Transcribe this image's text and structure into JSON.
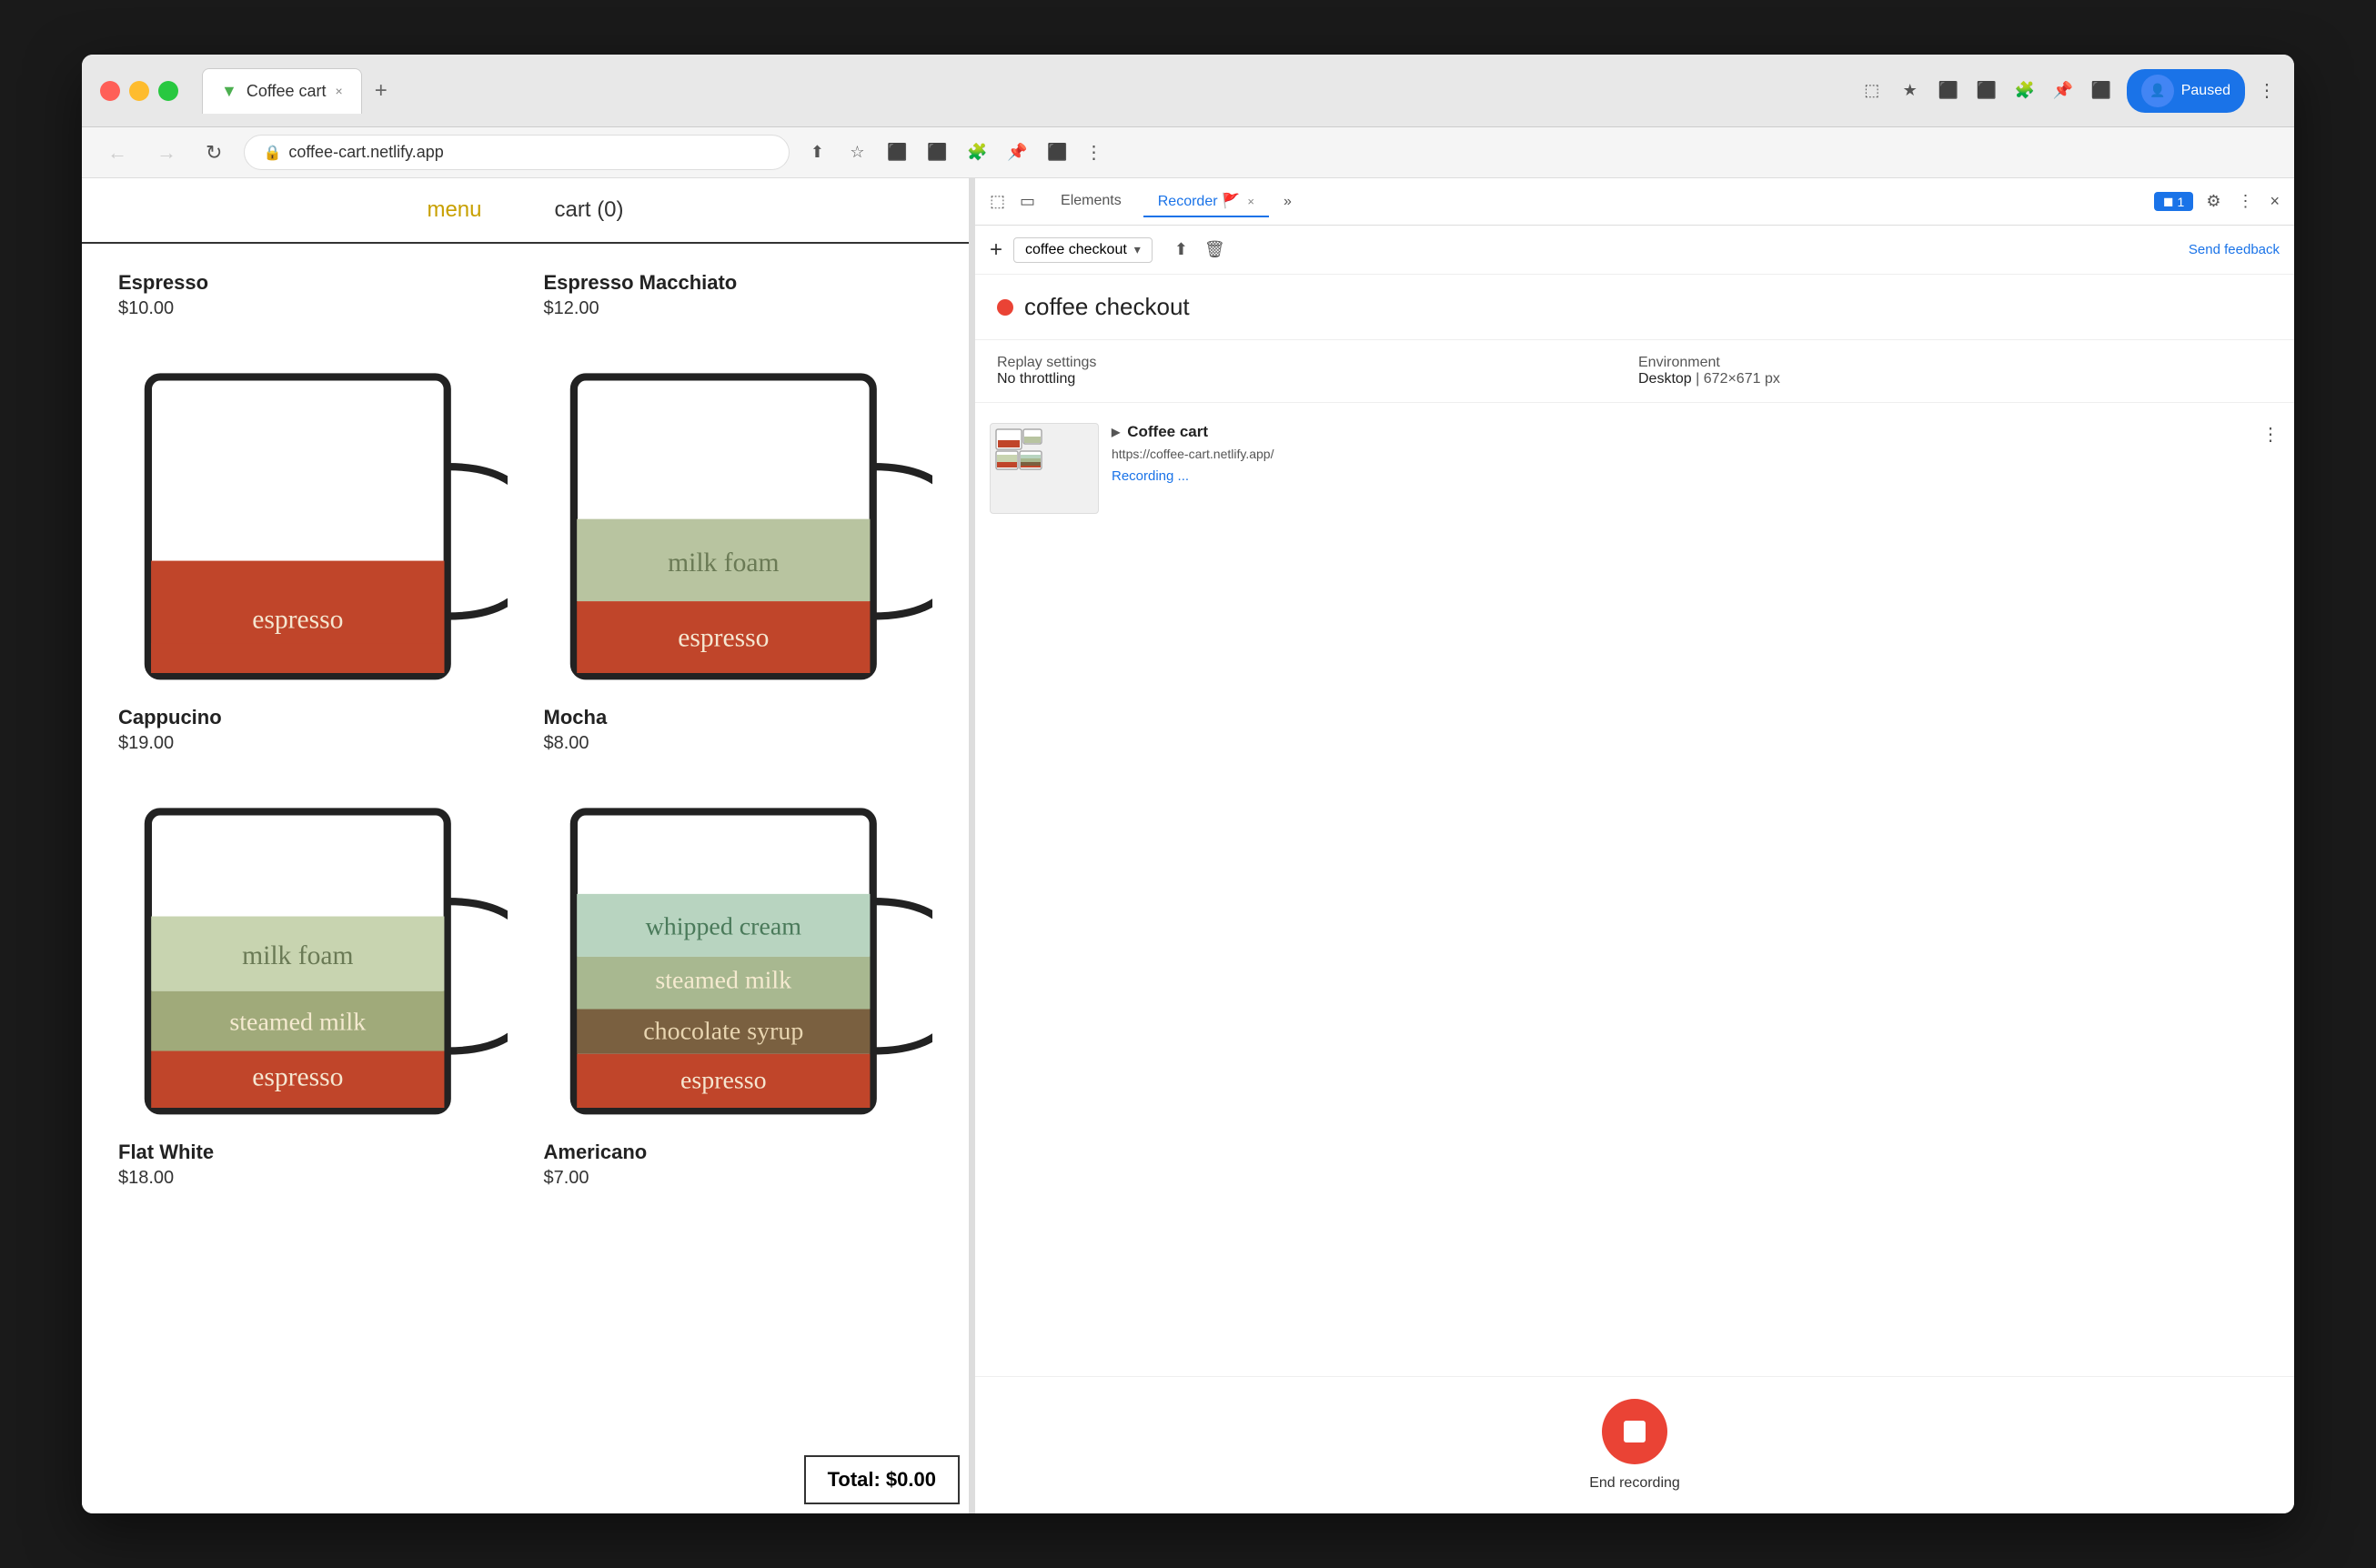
{
  "browser": {
    "tab_title": "Coffee cart",
    "tab_favicon": "▼",
    "address": "coffee-cart.netlify.app",
    "new_tab_label": "+",
    "close_tab_label": "×",
    "nav_back": "←",
    "nav_forward": "→",
    "nav_refresh": "↻",
    "paused_label": "Paused",
    "menu_dots": "⋮"
  },
  "coffee_app": {
    "nav_menu": "menu",
    "nav_cart": "cart (0)",
    "items": [
      {
        "name": "Espresso",
        "price": "$10.00",
        "layers": [
          {
            "label": "espresso",
            "color": "#c0452a",
            "height": 40
          }
        ]
      },
      {
        "name": "Espresso Macchiato",
        "price": "$12.00",
        "layers": [
          {
            "label": "milk foam",
            "color": "#b8c4a0",
            "height": 25
          },
          {
            "label": "espresso",
            "color": "#c0452a",
            "height": 40
          }
        ]
      },
      {
        "name": "Cappucino",
        "price": "$19.00",
        "layers": [
          {
            "label": "milk foam",
            "color": "#c8d4b0",
            "height": 30
          },
          {
            "label": "steamed milk",
            "color": "#a8b48a",
            "height": 22
          },
          {
            "label": "espresso",
            "color": "#c0452a",
            "height": 28
          }
        ]
      },
      {
        "name": "Mocha",
        "price": "$8.00",
        "layers": [
          {
            "label": "whipped cream",
            "color": "#b8d4c0",
            "height": 25
          },
          {
            "label": "steamed milk",
            "color": "#a8b890",
            "height": 22
          },
          {
            "label": "chocolate syrup",
            "color": "#7a6040",
            "height": 22
          },
          {
            "label": "espresso",
            "color": "#c0452a",
            "height": 25
          }
        ]
      },
      {
        "name": "Flat White",
        "price": "$18.00",
        "layers": []
      },
      {
        "name": "Americano",
        "price": "$7.00",
        "layers": []
      }
    ],
    "total": "Total: $0.00"
  },
  "devtools": {
    "tabs": [
      "Elements",
      "Recorder 🚩",
      ""
    ],
    "active_tab": "Recorder",
    "tab_close": "×",
    "more_tabs": "»",
    "chat_badge": "◼ 1",
    "settings_icon": "⚙",
    "menu_icon": "⋮",
    "close_icon": "×",
    "send_feedback": "Send feedback",
    "add_icon": "+",
    "recording_name": "coffee checkout",
    "recording_name_title": "coffee checkout",
    "dropdown_chevron": "▾",
    "upload_icon": "⬆",
    "delete_icon": "🗑",
    "replay_settings_label": "Replay settings",
    "environment_label": "Environment",
    "no_throttling": "No throttling",
    "desktop": "Desktop",
    "resolution": "672×671 px",
    "recording_item_name": "Coffee cart",
    "recording_item_url": "https://coffee-cart.netlify.app/",
    "recording_status": "Recording ...",
    "end_recording_label": "End recording",
    "more_options": "⋮"
  }
}
